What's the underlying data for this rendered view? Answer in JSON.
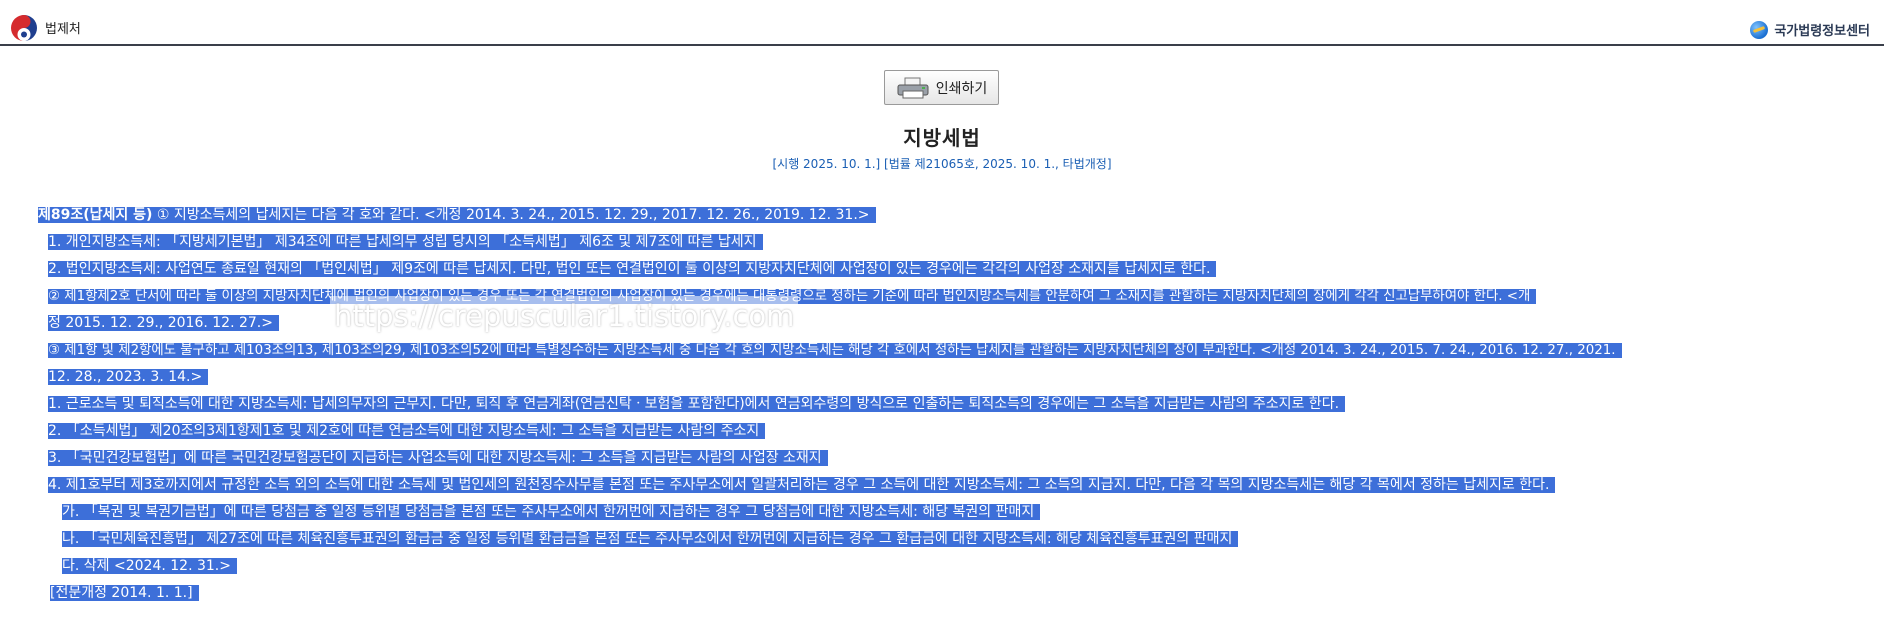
{
  "header": {
    "agency": "법제처",
    "center_name": "국가법령정보센터"
  },
  "toolbar": {
    "print_label": "인쇄하기"
  },
  "document": {
    "title": "지방세법",
    "enforcement": "[시행 2025. 10. 1.] [법률 제21065호, 2025. 10. 1., 타법개정]"
  },
  "article": {
    "heading": "제89조(납세지 등)",
    "lines": [
      "① 지방소득세의 납세지는 다음 각 호와 같다. <개정 2014. 3. 24., 2015. 12. 29., 2017. 12. 26., 2019. 12. 31.>",
      "1. 개인지방소득세: 「지방세기본법」 제34조에 따른 납세의무 성립 당시의 「소득세법」 제6조 및 제7조에 따른 납세지",
      "2. 법인지방소득세: 사업연도 종료일 현재의 「법인세법」 제9조에 따른 납세지. 다만, 법인 또는 연결법인이 둘 이상의 지방자치단체에 사업장이 있는 경우에는 각각의 사업장 소재지를 납세지로 한다.",
      "② 제1항제2호 단서에 따라 둘 이상의 지방자치단체에 법인의 사업장이 있는 경우 또는 각 연결법인의 사업장이 있는 경우에는 대통령령으로 정하는 기준에 따라 법인지방소득세를 안분하여 그 소재지를 관할하는 지방자치단체의 장에게 각각 신고납부하여야 한다. <개",
      "정 2015. 12. 29., 2016. 12. 27.>",
      "③ 제1항 및 제2항에도 불구하고 제103조의13, 제103조의29, 제103조의52에 따라 특별징수하는 지방소득세 중 다음 각 호의 지방소득세는 해당 각 호에서 정하는 납세지를 관할하는 지방자치단체의 장이 부과한다. <개정 2014. 3. 24., 2015. 7. 24., 2016. 12. 27., 2021.",
      "12. 28., 2023. 3. 14.>",
      "1. 근로소득 및 퇴직소득에 대한 지방소득세: 납세의무자의 근무지. 다만, 퇴직 후 연금계좌(연금신탁ㆍ보험을 포함한다)에서 연금외수령의 방식으로 인출하는 퇴직소득의 경우에는 그 소득을 지급받는 사람의 주소지로 한다.",
      "2. 「소득세법」 제20조의3제1항제1호 및 제2호에 따른 연금소득에 대한 지방소득세: 그 소득을 지급받는 사람의 주소지",
      "3. 「국민건강보험법」에 따른 국민건강보험공단이 지급하는 사업소득에 대한 지방소득세: 그 소득을 지급받는 사람의 사업장 소재지",
      "4. 제1호부터 제3호까지에서 규정한 소득 외의 소득에 대한 소득세 및 법인세의 원천징수사무를 본점 또는 주사무소에서 일괄처리하는 경우 그 소득에 대한 지방소득세: 그 소득의 지급지. 다만, 다음 각 목의 지방소득세는 해당 각 목에서 정하는 납세지로 한다.",
      "가. 「복권 및 복권기금법」에 따른 당첨금 중 일정 등위별 당첨금을 본점 또는 주사무소에서 한꺼번에 지급하는 경우 그 당첨금에 대한 지방소득세: 해당 복권의 판매지",
      "나. 「국민체육진흥법」 제27조에 따른 체육진흥투표권의 환급금 중 일정 등위별 환급금을 본점 또는 주사무소에서 한꺼번에 지급하는 경우 그 환급금에 대한 지방소득세: 해당 체육진흥투표권의 판매지",
      "다. 삭제 <2024. 12. 31.>",
      "[전문개정 2014. 1. 1.]"
    ]
  },
  "watermark": "https://crepuscular1.tistory.com"
}
